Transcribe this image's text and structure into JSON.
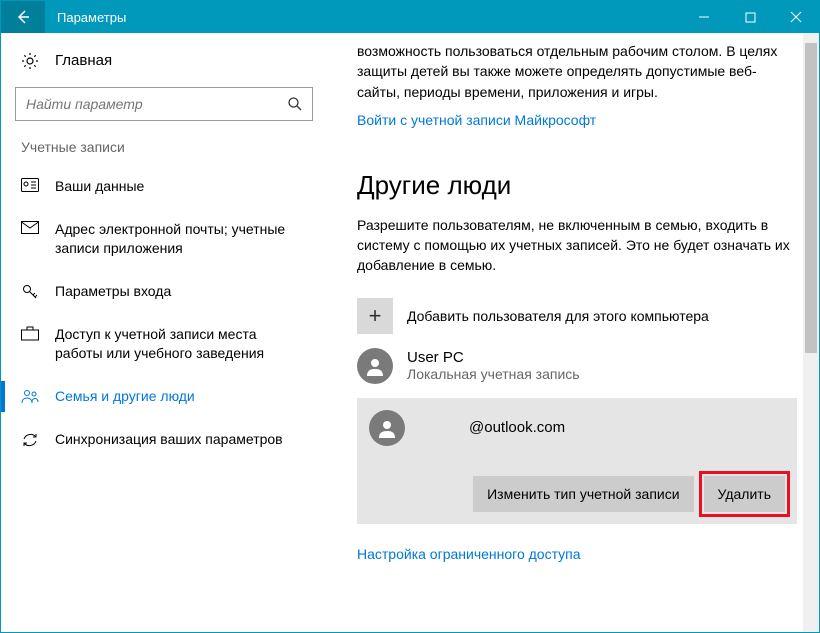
{
  "titlebar": {
    "title": "Параметры"
  },
  "sidebar": {
    "home": "Главная",
    "search_placeholder": "Найти параметр",
    "section": "Учетные записи",
    "items": [
      {
        "label": "Ваши данные"
      },
      {
        "label": "Адрес электронной почты; учетные записи приложения"
      },
      {
        "label": "Параметры входа"
      },
      {
        "label": "Доступ к учетной записи места работы или учебного заведения"
      },
      {
        "label": "Семья и другие люди"
      },
      {
        "label": "Синхронизация ваших параметров"
      }
    ]
  },
  "content": {
    "intro_sub": "возможность пользоваться отдельным рабочим столом. В целях защиты детей вы также можете определять допустимые веб-сайты, периоды времени, приложения и игры.",
    "ms_link": "Войти с учетной записи Майкрософт",
    "other_people_heading": "Другие люди",
    "other_people_desc": "Разрешите пользователям, не включенным в семью, входить в систему с помощью их учетных записей. Это не будет означать их добавление в семью.",
    "add_user": "Добавить пользователя для этого компьютера",
    "user1": {
      "name": "User PC",
      "type": "Локальная учетная запись"
    },
    "user2": {
      "email": "@outlook.com"
    },
    "btn_change": "Изменить тип учетной записи",
    "btn_delete": "Удалить",
    "restricted_link": "Настройка ограниченного доступа"
  }
}
